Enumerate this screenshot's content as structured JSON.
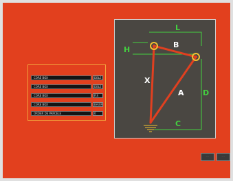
{
  "parameters": [
    {
      "label": "CORE  BOX",
      "value": "DBLE"
    },
    {
      "label": "CORE  BOX",
      "value": "DBLE"
    },
    {
      "label": "CORE  BOX",
      "value": "FIX"
    },
    {
      "label": "CORE  BOX",
      "value": "BAIXM"
    },
    {
      "label": "ORDER  DE  PARCELE",
      "value": "0"
    }
  ],
  "diagram": {
    "labels": {
      "L": "L",
      "H": "H",
      "B": "B",
      "X": "X",
      "A": "A",
      "D": "D",
      "C": "C"
    },
    "colors": {
      "arm": "#e04020",
      "guide": "#44d040",
      "joint": "#f2c030",
      "label": "#ffffff"
    }
  },
  "buttons": [
    {
      "label": "· · ·"
    },
    {
      "label": "· · ·"
    }
  ]
}
